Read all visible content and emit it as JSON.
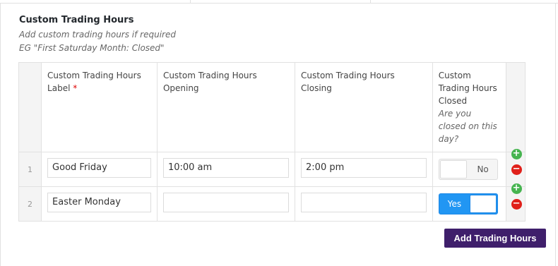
{
  "field": {
    "title": "Custom Trading Hours",
    "instructions_line1": "Add custom trading hours if required",
    "instructions_line2": "EG \"First Saturday Month: Closed\""
  },
  "columns": {
    "label_title": "Custom Trading Hours Label",
    "label_required": "*",
    "opening_title": "Custom Trading Hours Opening",
    "closing_title": "Custom Trading Hours Closing",
    "closed_title": "Custom Trading Hours Closed",
    "closed_instructions": "Are you closed on this day?"
  },
  "rows": [
    {
      "order": "1",
      "label": "Good Friday",
      "opening": "10:00 am",
      "closing": "2:00 pm",
      "closed_text": "No",
      "closed": false
    },
    {
      "order": "2",
      "label": "Easter Monday",
      "opening": "",
      "closing": "",
      "closed_text": "Yes",
      "closed": true
    }
  ],
  "icons": {
    "add": "plus-circle-icon",
    "remove": "minus-circle-icon"
  },
  "actions": {
    "add_row_label": "Add Trading Hours"
  },
  "colors": {
    "accent": "#3f1f6b",
    "toggle_on": "#2196f3",
    "add": "#46b450",
    "remove": "#e0201a"
  }
}
